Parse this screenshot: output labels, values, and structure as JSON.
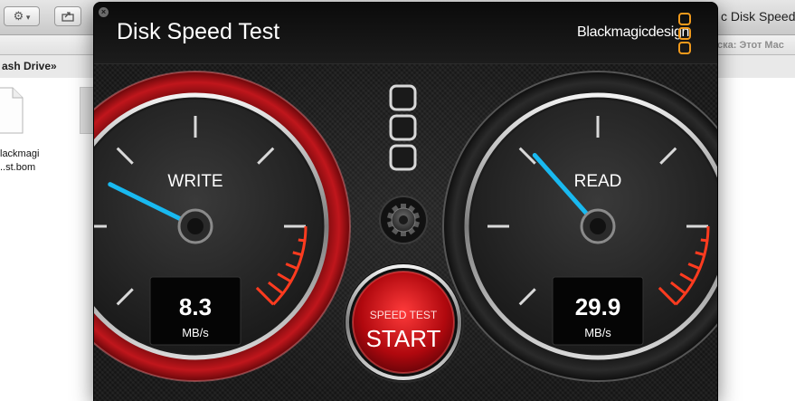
{
  "finder": {
    "title_fragment": "c Disk Speed T",
    "path_fragment": "ash Drive»",
    "location_fragment": "ска: Этот Mac",
    "file_name_line1": "lackmagi",
    "file_name_line2": "..st.bom"
  },
  "app": {
    "title": "Disk Speed Test",
    "brand": "Blackmagicdesign",
    "close_glyph": "×"
  },
  "write": {
    "label": "WRITE",
    "value": "8.3",
    "unit": "MB/s"
  },
  "read": {
    "label": "READ",
    "value": "29.9",
    "unit": "MB/s"
  },
  "start": {
    "line1": "SPEED TEST",
    "line2": "START"
  },
  "icons": [
    "gear-icon",
    "share-icon",
    "settings-gear-icon",
    "speed-test-selector-icon",
    "close-icon",
    "blackmagic-logo-icon"
  ],
  "colors": {
    "needle": "#19b9f0",
    "redline": "#ff3b1f",
    "write_bezel": "#b0141a",
    "start_button": "#d0141a"
  }
}
